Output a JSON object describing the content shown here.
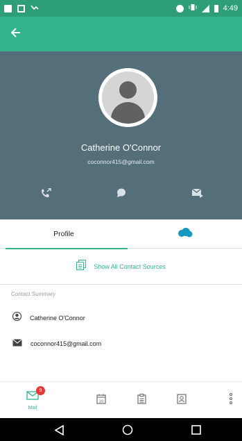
{
  "status_bar": {
    "time": "4:49"
  },
  "contact": {
    "name": "Catherine O'Connor",
    "email": "coconnor415@gmail.com"
  },
  "tabs": {
    "profile_label": "Profile"
  },
  "show_all": {
    "label": "Show All Contact Sources"
  },
  "summary": {
    "title": "Contact Summary",
    "rows": [
      {
        "icon": "person-circle-icon",
        "text": "Catherine O'Connor"
      },
      {
        "icon": "mail-icon",
        "text": "coconnor415@gmail.com"
      }
    ]
  },
  "bottom_nav": {
    "mail_label": "Mail",
    "mail_badge": "9"
  },
  "colors": {
    "accent": "#34b28e",
    "status_bar": "#2e9e79",
    "header_bg": "#546e7a",
    "badge": "#e53935",
    "salesforce": "#1798c1"
  }
}
